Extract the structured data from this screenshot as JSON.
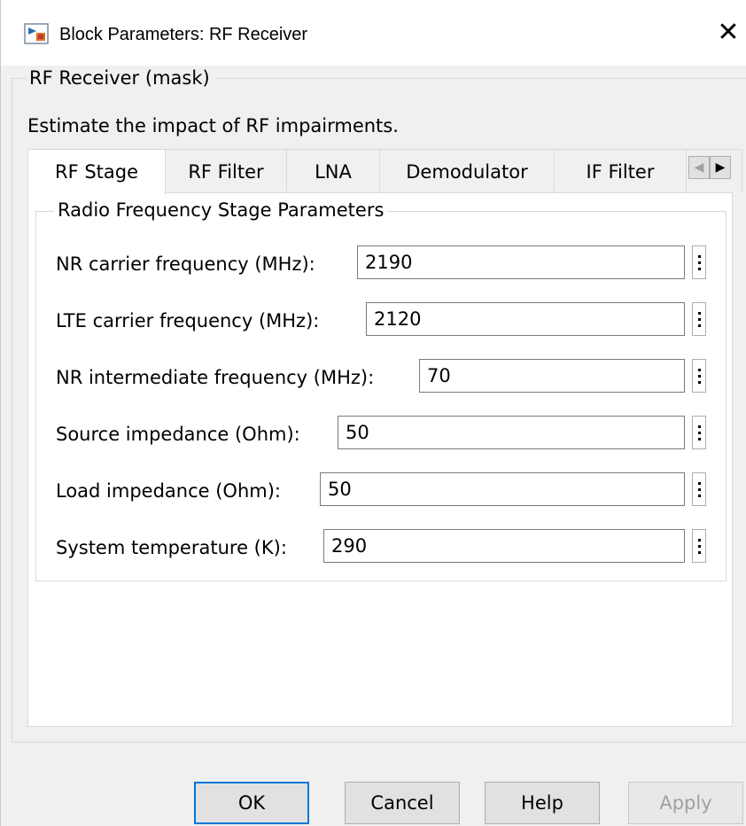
{
  "window": {
    "title": "Block Parameters: RF Receiver",
    "close_symbol": "✕"
  },
  "mask": {
    "title": "RF Receiver (mask)",
    "description": "Estimate the impact of RF impairments."
  },
  "tabs": [
    {
      "label": "RF Stage",
      "active": true
    },
    {
      "label": "RF Filter",
      "active": false
    },
    {
      "label": "LNA",
      "active": false
    },
    {
      "label": "Demodulator",
      "active": false
    },
    {
      "label": "IF Filter",
      "active": false
    }
  ],
  "tab_scroll": {
    "left": "◀",
    "right": "▶"
  },
  "group": {
    "title": "Radio Frequency Stage Parameters",
    "params": [
      {
        "label": "NR carrier frequency (MHz):",
        "value": "2190"
      },
      {
        "label": "LTE carrier frequency (MHz):",
        "value": "2120"
      },
      {
        "label": "NR intermediate frequency (MHz):",
        "value": "70"
      },
      {
        "label": "Source impedance (Ohm):",
        "value": "50"
      },
      {
        "label": "Load impedance (Ohm):",
        "value": "50"
      },
      {
        "label": "System temperature (K):",
        "value": "290"
      }
    ]
  },
  "buttons": {
    "ok": "OK",
    "cancel": "Cancel",
    "help": "Help",
    "apply": "Apply"
  },
  "colors": {
    "accent": "#0078d7",
    "window_bg": "#f0f0f0",
    "panel_bg": "#ffffff"
  }
}
